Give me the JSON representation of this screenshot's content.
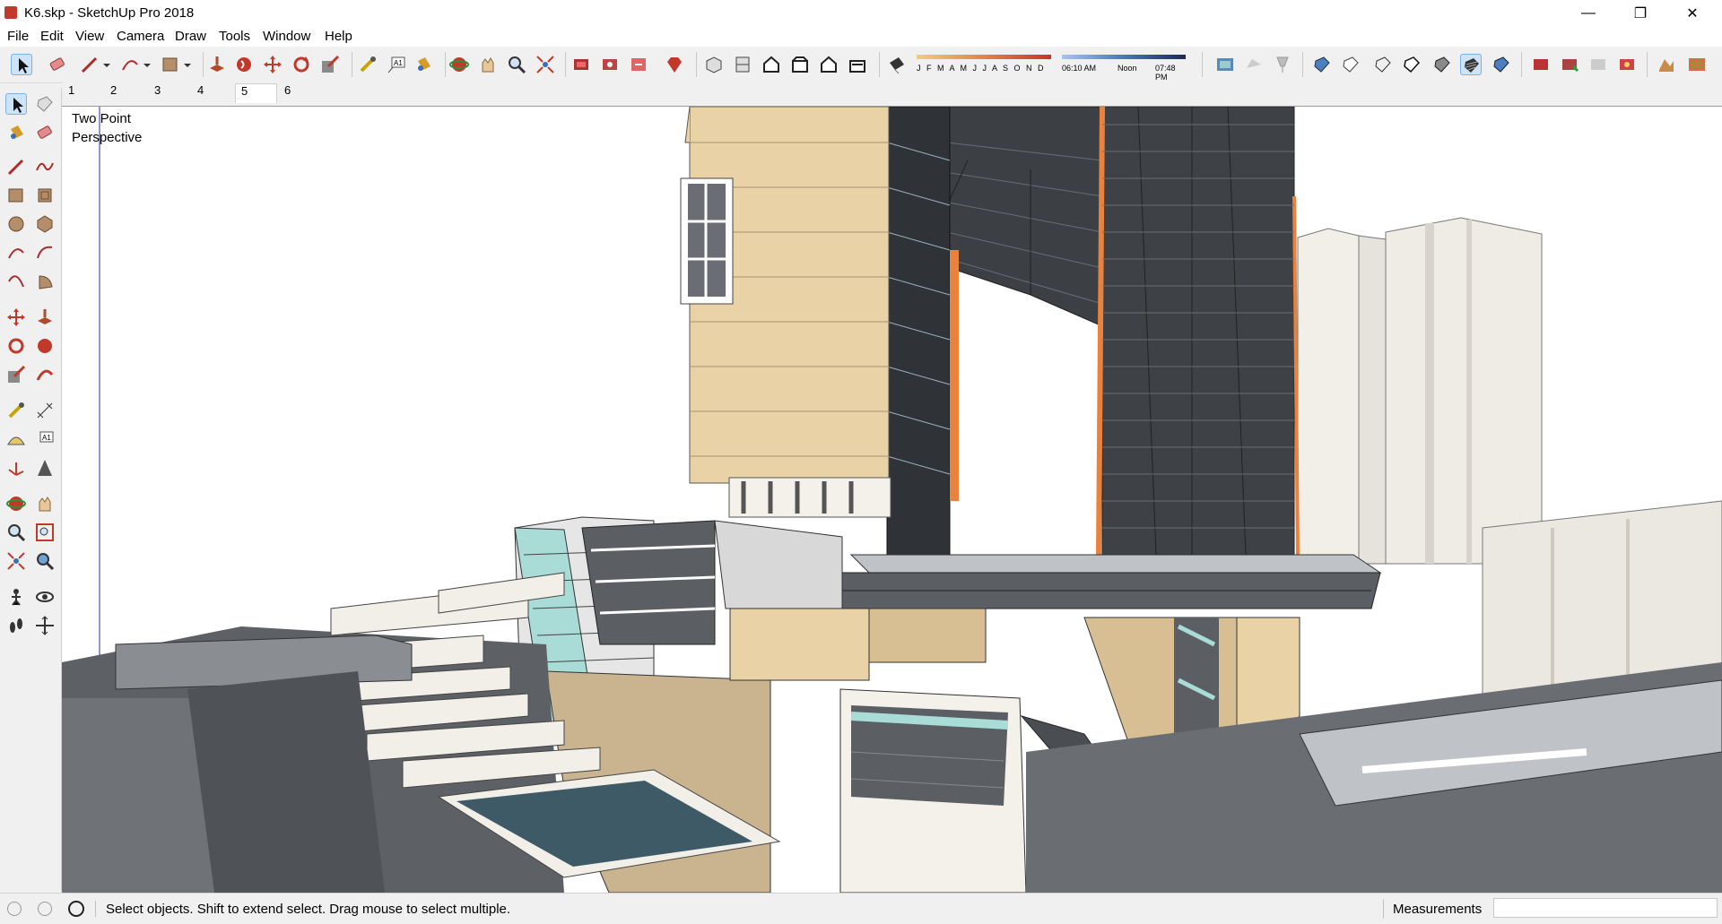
{
  "window": {
    "title": "K6.skp - SketchUp Pro 2018",
    "minimize": "—",
    "restore": "❐",
    "close": "✕"
  },
  "menu": [
    "File",
    "Edit",
    "View",
    "Camera",
    "Draw",
    "Tools",
    "Window",
    "Help"
  ],
  "shadow_settings": {
    "months": "J F M A M J J A S O N D",
    "time_start": "06:10 AM",
    "time_mid": "Noon",
    "time_end": "07:48 PM"
  },
  "scene_tabs": [
    "1",
    "2",
    "3",
    "4",
    "5",
    "6"
  ],
  "active_scene": "5",
  "viewport": {
    "camera_mode_line1": "Two Point",
    "camera_mode_line2": "Perspective"
  },
  "status": {
    "hint": "Select objects. Shift to extend select. Drag mouse to select multiple.",
    "measurements_label": "Measurements",
    "measurements_value": ""
  },
  "colors": {
    "accent_selected": "#cde3f7",
    "facade_tan": "#e9d3a6",
    "glass_dark": "#4a4d52",
    "glass_teal": "#a9dcd6",
    "accent_orange": "#e8823d"
  }
}
